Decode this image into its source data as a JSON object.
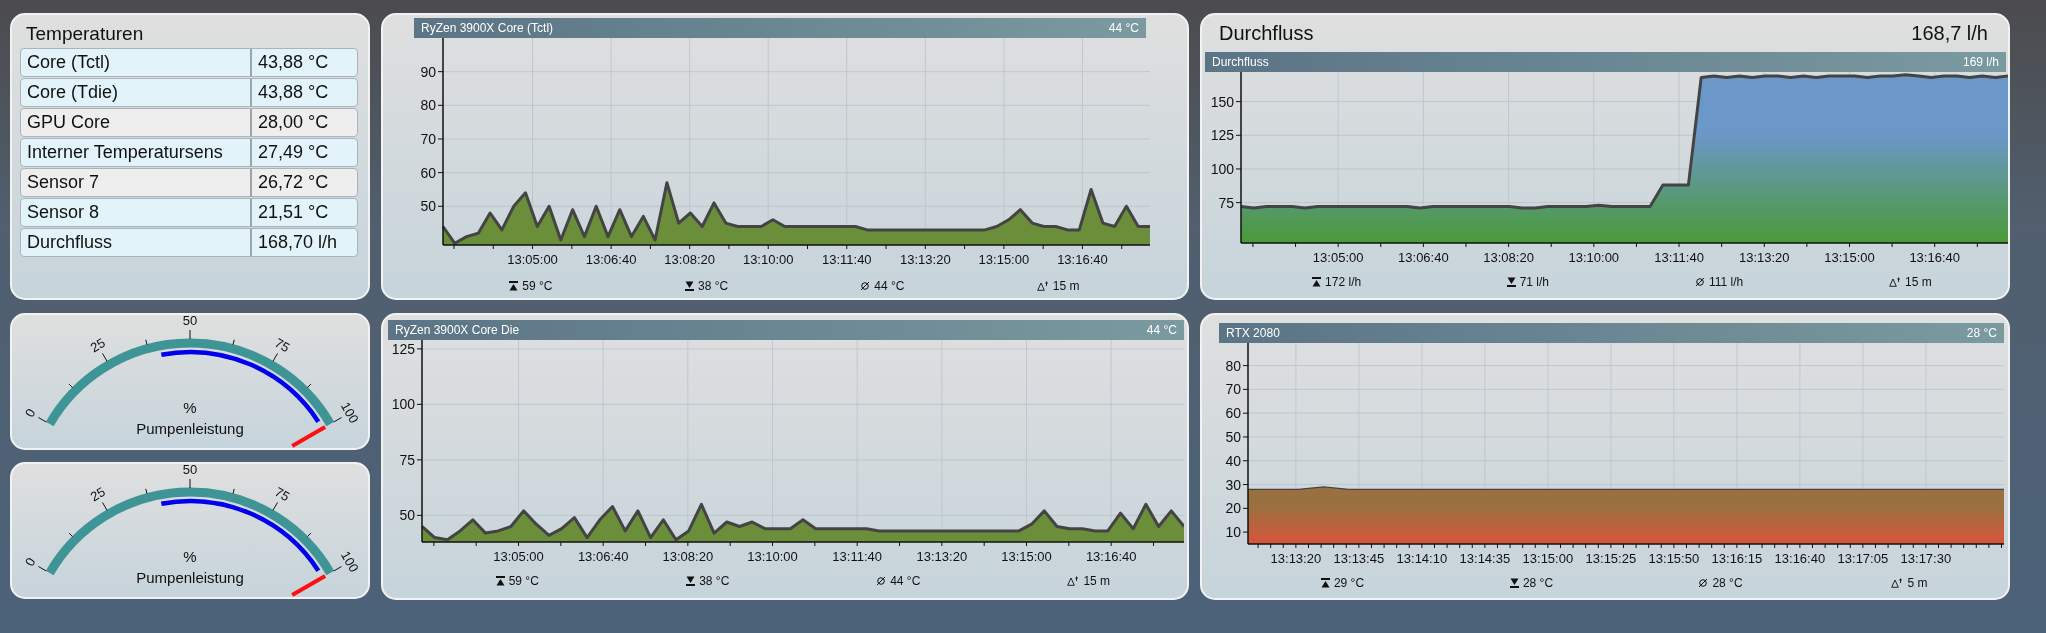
{
  "temperatures": {
    "title": "Temperaturen",
    "rows": [
      {
        "name": "Core (Tctl)",
        "value": "43,88 °C",
        "color": "#e2f3fa"
      },
      {
        "name": "Core (Tdie)",
        "value": "43,88 °C",
        "color": "#e2f3fa"
      },
      {
        "name": "GPU Core",
        "value": "28,00 °C",
        "color": "#eeeeee"
      },
      {
        "name": "Interner Temperatursens",
        "value": "27,49 °C",
        "color": "#e2f3fa"
      },
      {
        "name": "Sensor 7",
        "value": "26,72 °C",
        "color": "#eeeeee"
      },
      {
        "name": "Sensor 8",
        "value": "21,51 °C",
        "color": "#e2f3fa"
      },
      {
        "name": "Durchfluss",
        "value": "168,70 l/h",
        "color": "#e2f3fa"
      }
    ]
  },
  "charts": [
    {
      "current": "44 °C",
      "stats": [
        {
          "kind": "max",
          "text": "59 °C"
        },
        {
          "kind": "min",
          "text": "38 °C"
        },
        {
          "kind": "avg",
          "text": "44 °C"
        },
        {
          "kind": "span",
          "text": "15 m"
        }
      ],
      "chart_data": {
        "type": "area",
        "title": "RyZen 3900X Core (Tctl)",
        "grid": true,
        "x": [
          46986,
          47001,
          47016,
          47031,
          47046,
          47061,
          47076,
          47091,
          47106,
          47121,
          47136,
          47151,
          47166,
          47181,
          47196,
          47211,
          47226,
          47241,
          47256,
          47271,
          47286,
          47301,
          47316,
          47331,
          47346,
          47361,
          47376,
          47391,
          47406,
          47421,
          47436,
          47451,
          47466,
          47481,
          47496,
          47511,
          47526,
          47541,
          47556,
          47571,
          47586,
          47601,
          47616,
          47631,
          47646,
          47661,
          47676,
          47691,
          47706,
          47721,
          47736,
          47751,
          47766,
          47781,
          47796,
          47811,
          47826,
          47841,
          47856,
          47871,
          47886
        ],
        "xlim": [
          46986,
          47886
        ],
        "ylim": [
          38.5,
          100
        ],
        "yticks": [
          50,
          60,
          70,
          80,
          90
        ],
        "xticks": [
          {
            "value": 47100,
            "label": "13:05:00"
          },
          {
            "value": 47200,
            "label": "13:06:40"
          },
          {
            "value": 47300,
            "label": "13:08:20"
          },
          {
            "value": 47400,
            "label": "13:10:00"
          },
          {
            "value": 47500,
            "label": "13:11:40"
          },
          {
            "value": 47600,
            "label": "13:13:20"
          },
          {
            "value": 47700,
            "label": "13:15:00"
          },
          {
            "value": 47800,
            "label": "13:16:40"
          }
        ],
        "series": [
          {
            "color": "#6b8e3a",
            "values": [
              44,
              39,
              41,
              42,
              48,
              43,
              50,
              54,
              44,
              50,
              40,
              49,
              41,
              50,
              41,
              49,
              41,
              47,
              40,
              57,
              45,
              48,
              44,
              51,
              45,
              44,
              44,
              44,
              46,
              44,
              44,
              44,
              44,
              44,
              44,
              44,
              43,
              43,
              43,
              43,
              43,
              43,
              43,
              43,
              43,
              43,
              43,
              44,
              46,
              49,
              45,
              44,
              44,
              43,
              43,
              55,
              45,
              44,
              50,
              44,
              44
            ]
          }
        ]
      }
    },
    {
      "heading": {
        "title": "Durchfluss",
        "value": "168,7 l/h"
      },
      "current": "169 l/h",
      "fill_end": {
        "color": "#4a9a38"
      },
      "stats": [
        {
          "kind": "max",
          "text": "172 l/h"
        },
        {
          "kind": "min",
          "text": "71 l/h"
        },
        {
          "kind": "avg",
          "text": "111 l/h"
        },
        {
          "kind": "span",
          "text": "15 m"
        }
      ],
      "chart_data": {
        "type": "area",
        "title": "Durchfluss",
        "grid": true,
        "x": [
          46986,
          47001,
          47016,
          47031,
          47046,
          47061,
          47076,
          47091,
          47106,
          47121,
          47136,
          47151,
          47166,
          47181,
          47196,
          47211,
          47226,
          47241,
          47256,
          47271,
          47286,
          47301,
          47316,
          47331,
          47346,
          47361,
          47376,
          47391,
          47406,
          47421,
          47436,
          47451,
          47466,
          47481,
          47496,
          47511,
          47526,
          47541,
          47556,
          47571,
          47586,
          47601,
          47616,
          47631,
          47646,
          47661,
          47676,
          47691,
          47706,
          47721,
          47736,
          47751,
          47766,
          47781,
          47796,
          47811,
          47826,
          47841,
          47856,
          47871,
          47886
        ],
        "xlim": [
          46986,
          47886
        ],
        "ylim": [
          45,
          172
        ],
        "yticks": [
          75,
          100,
          125,
          150
        ],
        "xticks": [
          {
            "value": 47100,
            "label": "13:05:00"
          },
          {
            "value": 47200,
            "label": "13:06:40"
          },
          {
            "value": 47300,
            "label": "13:08:20"
          },
          {
            "value": 47400,
            "label": "13:10:00"
          },
          {
            "value": 47500,
            "label": "13:11:40"
          },
          {
            "value": 47600,
            "label": "13:13:20"
          },
          {
            "value": 47700,
            "label": "13:15:00"
          },
          {
            "value": 47800,
            "label": "13:16:40"
          }
        ],
        "series": [
          {
            "color": "#6b97c9",
            "values": [
              72,
              71,
              72,
              72,
              72,
              71,
              72,
              72,
              72,
              72,
              72,
              72,
              72,
              72,
              71,
              72,
              72,
              72,
              72,
              72,
              72,
              72,
              71,
              71,
              72,
              72,
              72,
              72,
              73,
              72,
              72,
              72,
              72,
              88,
              88,
              88,
              168,
              169,
              168,
              169,
              168,
              169,
              169,
              168,
              169,
              168,
              169,
              169,
              169,
              168,
              169,
              169,
              170,
              169,
              168,
              169,
              169,
              168,
              169,
              168,
              169
            ]
          }
        ]
      }
    },
    {
      "current": "44 °C",
      "stats": [
        {
          "kind": "max",
          "text": "59 °C"
        },
        {
          "kind": "min",
          "text": "38 °C"
        },
        {
          "kind": "avg",
          "text": "44 °C"
        },
        {
          "kind": "span",
          "text": "15 m"
        }
      ],
      "chart_data": {
        "type": "area",
        "title": "RyZen 3900X Core Die",
        "grid": true,
        "x": [
          46986,
          47001,
          47016,
          47031,
          47046,
          47061,
          47076,
          47091,
          47106,
          47121,
          47136,
          47151,
          47166,
          47181,
          47196,
          47211,
          47226,
          47241,
          47256,
          47271,
          47286,
          47301,
          47316,
          47331,
          47346,
          47361,
          47376,
          47391,
          47406,
          47421,
          47436,
          47451,
          47466,
          47481,
          47496,
          47511,
          47526,
          47541,
          47556,
          47571,
          47586,
          47601,
          47616,
          47631,
          47646,
          47661,
          47676,
          47691,
          47706,
          47721,
          47736,
          47751,
          47766,
          47781,
          47796,
          47811,
          47826,
          47841,
          47856,
          47871,
          47886
        ],
        "xlim": [
          46986,
          47886
        ],
        "ylim": [
          38,
          129
        ],
        "yticks": [
          50,
          75,
          100,
          125
        ],
        "xticks": [
          {
            "value": 47100,
            "label": "13:05:00"
          },
          {
            "value": 47200,
            "label": "13:06:40"
          },
          {
            "value": 47300,
            "label": "13:08:20"
          },
          {
            "value": 47400,
            "label": "13:10:00"
          },
          {
            "value": 47500,
            "label": "13:11:40"
          },
          {
            "value": 47600,
            "label": "13:13:20"
          },
          {
            "value": 47700,
            "label": "13:15:00"
          },
          {
            "value": 47800,
            "label": "13:16:40"
          }
        ],
        "series": [
          {
            "color": "#6b8e3a",
            "values": [
              45,
              40,
              39,
              43,
              48,
              42,
              43,
              45,
              52,
              46,
              41,
              44,
              49,
              40,
              48,
              54,
              43,
              52,
              40,
              48,
              39,
              43,
              55,
              42,
              47,
              45,
              47,
              44,
              44,
              44,
              48,
              44,
              44,
              44,
              44,
              44,
              43,
              43,
              43,
              43,
              43,
              43,
              43,
              43,
              43,
              43,
              43,
              43,
              46,
              52,
              45,
              44,
              44,
              43,
              43,
              51,
              44,
              55,
              45,
              52,
              45
            ]
          }
        ]
      }
    },
    {
      "current": "28 °C",
      "fill_end": {
        "color": "#d9553b"
      },
      "stats": [
        {
          "kind": "max",
          "text": "29 °C"
        },
        {
          "kind": "min",
          "text": "28 °C"
        },
        {
          "kind": "avg",
          "text": "28 °C"
        },
        {
          "kind": "span",
          "text": "5 m"
        }
      ],
      "chart_data": {
        "type": "area",
        "title": "RTX 2080",
        "grid": true,
        "x": [
          47581,
          47591,
          47601,
          47611,
          47621,
          47631,
          47641,
          47651,
          47661,
          47671,
          47681,
          47691,
          47701,
          47711,
          47721,
          47731,
          47741,
          47751,
          47761,
          47771,
          47781,
          47791,
          47801,
          47811,
          47821,
          47831,
          47841,
          47851,
          47861,
          47871,
          47881
        ],
        "xlim": [
          47581,
          47881
        ],
        "ylim": [
          5,
          89.5
        ],
        "yticks": [
          10,
          20,
          30,
          40,
          50,
          60,
          70,
          80
        ],
        "xticks": [
          {
            "value": 47600,
            "label": "13:13:20"
          },
          {
            "value": 47625,
            "label": "13:13:45"
          },
          {
            "value": 47650,
            "label": "13:14:10"
          },
          {
            "value": 47675,
            "label": "13:14:35"
          },
          {
            "value": 47700,
            "label": "13:15:00"
          },
          {
            "value": 47725,
            "label": "13:15:25"
          },
          {
            "value": 47750,
            "label": "13:15:50"
          },
          {
            "value": 47775,
            "label": "13:16:15"
          },
          {
            "value": 47800,
            "label": "13:16:40"
          },
          {
            "value": 47825,
            "label": "13:17:05"
          },
          {
            "value": 47850,
            "label": "13:17:30"
          }
        ],
        "series": [
          {
            "color": "#9a7040",
            "values": [
              28,
              28,
              28,
              29,
              28,
              28,
              28,
              28,
              28,
              28,
              28,
              28,
              28,
              28,
              28,
              28,
              28,
              28,
              28,
              28,
              28,
              28,
              28,
              28,
              28,
              28,
              28,
              28,
              28,
              28,
              28
            ]
          }
        ]
      }
    }
  ],
  "gauges": [
    {
      "ticks": [
        "0",
        "25",
        "50",
        "75",
        "100"
      ],
      "unit": "%",
      "label": "Pumpenleistung",
      "level": 1.0
    },
    {
      "ticks": [
        "0",
        "25",
        "50",
        "75",
        "100"
      ],
      "unit": "%",
      "label": "Pumpenleistung",
      "level": 1.0
    }
  ]
}
